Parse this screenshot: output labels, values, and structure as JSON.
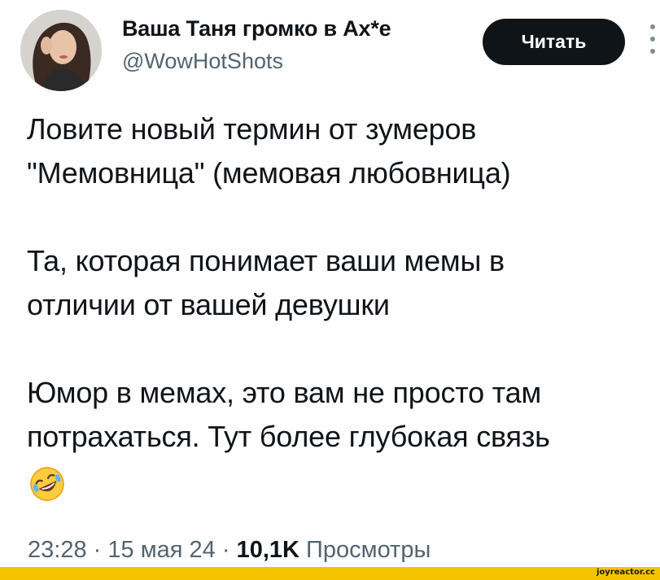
{
  "header": {
    "display_name": "Ваша Таня громко в Ах*е",
    "handle": "@WowHotShots",
    "follow_label": "Читать",
    "avatar_icon": "avatar-photo",
    "more_icon": "more-vertical-icon"
  },
  "tweet": {
    "lines": [
      "Ловите новый термин от зумеров",
      "\"Мемовница\" (мемовая любовница)",
      "Та, которая понимает ваши мемы в",
      "отличии от вашей девушки",
      "Юмор в мемах, это вам не просто там",
      "потрахаться. Тут более глубокая связь"
    ],
    "emoji": "🤣"
  },
  "meta": {
    "time": "23:28",
    "separator": "·",
    "date": "15 мая 24",
    "views_count": "10,1K",
    "views_label": "Просмотры"
  },
  "footer": {
    "watermark": "joyreactor.cc",
    "bar_color": "#f5c400"
  },
  "colors": {
    "text_primary": "#0f1419",
    "text_secondary": "#536471",
    "button_bg": "#0f1419",
    "button_text": "#ffffff"
  }
}
